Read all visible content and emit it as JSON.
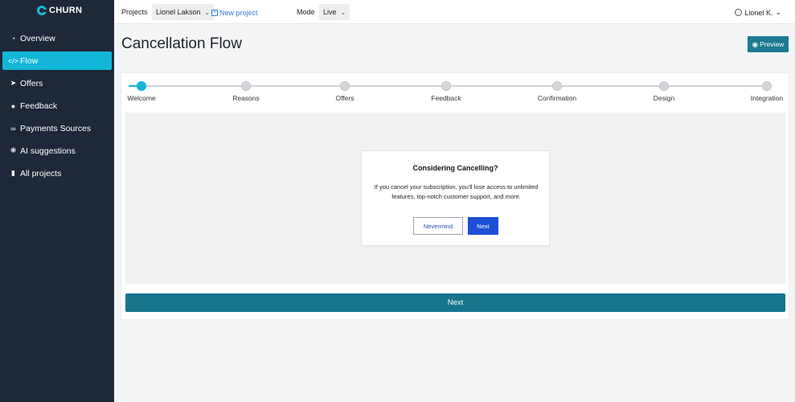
{
  "brand": {
    "name": "CHURN",
    "accent": "#13b6d6",
    "sidebar_bg": "#1e2839"
  },
  "sidebar": {
    "items": [
      {
        "label": "Overview",
        "icon": "pie-chart-icon",
        "active": false
      },
      {
        "label": "Flow",
        "icon": "code-icon",
        "active": true
      },
      {
        "label": "Offers",
        "icon": "rocket-icon",
        "active": false
      },
      {
        "label": "Feedback",
        "icon": "comments-icon",
        "active": false
      },
      {
        "label": "Payments Sources",
        "icon": "link-icon",
        "active": false
      },
      {
        "label": "AI suggestions",
        "icon": "sparkle-icon",
        "active": false
      },
      {
        "label": "All projects",
        "icon": "folder-icon",
        "active": false
      }
    ]
  },
  "topbar": {
    "projects_label": "Projects",
    "project_selected": "Lionel Lakson",
    "new_project_label": "New project",
    "mode_label": "Mode",
    "mode_selected": "Live",
    "user_name": "Lionel K."
  },
  "page": {
    "title": "Cancellation Flow",
    "preview_label": "Preview"
  },
  "stepper": {
    "steps": [
      {
        "label": "Welcome",
        "active": true
      },
      {
        "label": "Reasons",
        "active": false
      },
      {
        "label": "Offers",
        "active": false
      },
      {
        "label": "Feedback",
        "active": false
      },
      {
        "label": "Confirmation",
        "active": false
      },
      {
        "label": "Design",
        "active": false
      },
      {
        "label": "Integration",
        "active": false
      }
    ]
  },
  "modal": {
    "title": "Considering Cancelling?",
    "body": "If you cancel your subscription, you'll lose access to unlimited features, top-notch customer support, and more.",
    "nevermind_label": "Nevermind",
    "next_label": "Next"
  },
  "footer": {
    "next_label": "Next"
  }
}
